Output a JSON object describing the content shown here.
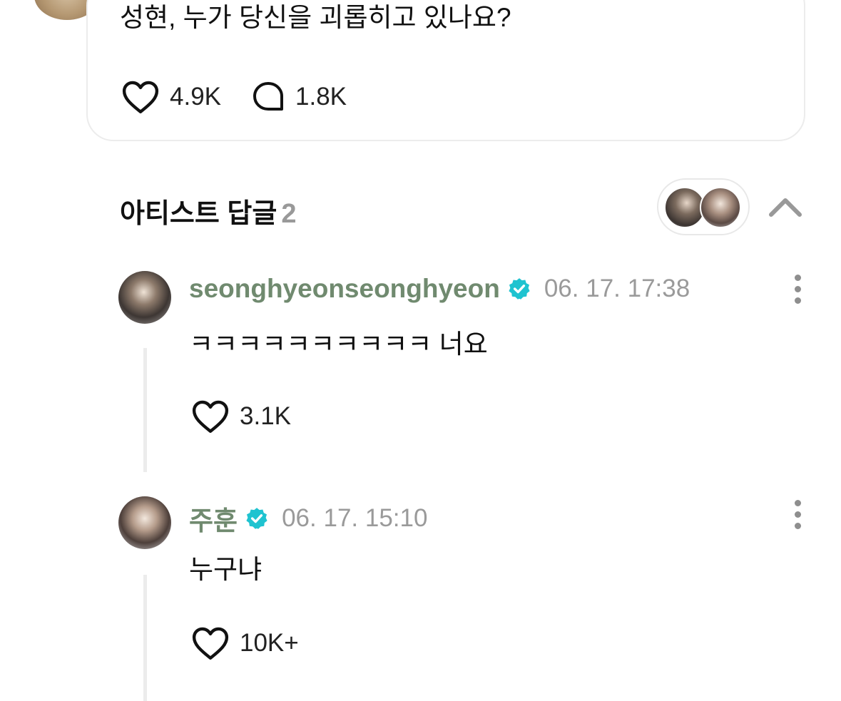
{
  "post": {
    "text": "성현, 누가 당신을 괴롭히고 있나요?",
    "likes": "4.9K",
    "comments": "1.8K"
  },
  "artist_replies": {
    "title": "아티스트 답글",
    "count": "2"
  },
  "replies": [
    {
      "username": "seonghyeonseonghyeon",
      "timestamp": "06. 17. 17:38",
      "text": "ㅋㅋㅋㅋㅋㅋㅋㅋㅋㅋ 너요",
      "likes": "3.1K",
      "verified": true
    },
    {
      "username": "주훈",
      "timestamp": "06. 17. 15:10",
      "text": "누구냐",
      "likes": "10K+",
      "verified": true
    }
  ],
  "colors": {
    "username": "#708a6f",
    "verified_badge": "#1fc3d0",
    "timestamp": "#9a9a9a",
    "divider": "#ececec"
  },
  "icons": {
    "like": "heart-icon",
    "comment": "speech-bubble-icon",
    "verified": "verified-badge-icon",
    "more": "more-vertical-icon",
    "collapse": "chevron-up-icon"
  }
}
